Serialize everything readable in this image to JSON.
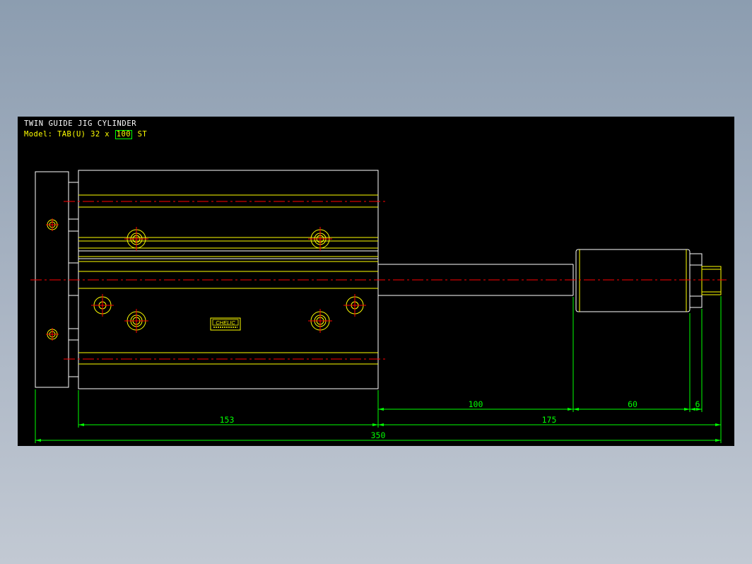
{
  "title": "TWIN GUIDE JIG CYLINDER",
  "model": {
    "label": "Model:",
    "code": "TAB(U) 32 x ",
    "stroke": "100",
    "suffix": " ST"
  },
  "brand_plate": "CHELIC",
  "dimensions": {
    "body_length": "153",
    "stroke": "100",
    "rod_total": "175",
    "end_block": "60",
    "thread": "6",
    "overall": "350"
  },
  "colors": {
    "background": "#000000",
    "outline": "#ffffff",
    "feature": "#ffff00",
    "centerline": "#ff0000",
    "dimension": "#00ff00"
  }
}
